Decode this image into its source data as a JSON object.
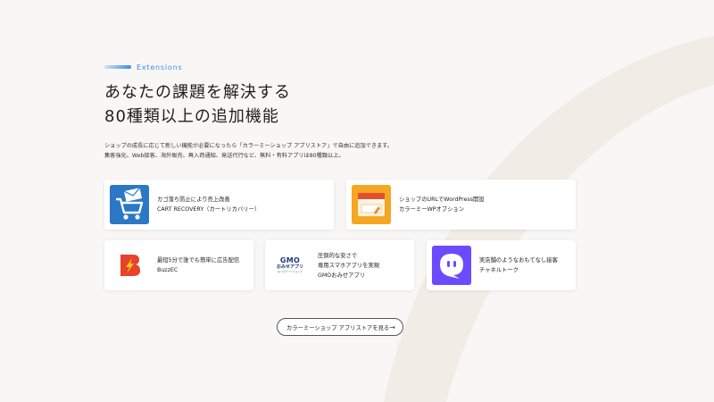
{
  "header": {
    "eyebrow": "Extensions",
    "title_line1": "あなたの課題を解決する",
    "title_line2": "80種類以上の追加機能",
    "desc_line1": "ショップの成長に応じて新しい機能が必要になったら「カラーミーショップ アプリストア」で自由に追加できます。",
    "desc_line2": "集客強化、Web接客、海外販売、再入荷通知、発送代行など、無料・有料アプリは80種類以上。"
  },
  "apps": [
    {
      "line1": "カゴ落ち防止により売上改善",
      "line2": "CART RECOVERY（カートリカバリー）",
      "line3": "",
      "icon": "cart-mail-icon"
    },
    {
      "line1": "ショップのURLでWordPress開設",
      "line2": "カラーミーWPオプション",
      "line3": "",
      "icon": "shop-window-icon"
    },
    {
      "line1": "最短5分で誰でも簡単に広告配信",
      "line2": "BuzzEC",
      "line3": "",
      "icon": "buzzec-logo-icon"
    },
    {
      "line1": "圧倒的な安さで",
      "line2": "専用スマホアプリを実現",
      "line3": "GMOおみせアプリ",
      "icon": "gmo-omise-app-logo",
      "logo_text_1": "GMO",
      "logo_text_2": "おみせアプリ",
      "logo_text_3": "by カラーミーショップ"
    },
    {
      "line1": "実店舗のようなおもてなし接客",
      "line2": "チャネルトーク",
      "line3": "",
      "icon": "chat-bubble-icon"
    }
  ],
  "cta": {
    "label": "カラーミーショップ アプリストアを見る",
    "arrow": "→"
  },
  "colors": {
    "accent": "#3f8ae8",
    "cart_blue": "#2b78c4",
    "shop_orange": "#f5a623",
    "buzz_red": "#e8412c",
    "channel_purple": "#6b4bff",
    "gmo_navy": "#1e3a7a"
  }
}
